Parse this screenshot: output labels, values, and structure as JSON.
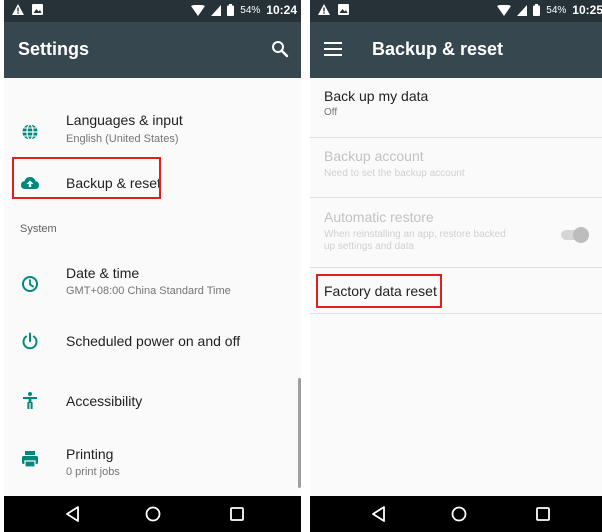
{
  "colors": {
    "status_bar": "#263238",
    "app_bar": "#37474f",
    "accent_icon": "#00897b",
    "highlight": "#e02020",
    "nav_bar": "#000000"
  },
  "left_phone": {
    "status": {
      "battery_percent": "54%",
      "time": "10:24"
    },
    "app_bar": {
      "title": "Settings",
      "action_icon": "search-icon"
    },
    "items": [
      {
        "icon": "globe-icon",
        "title": "Languages & input",
        "subtitle": "English (United States)"
      },
      {
        "icon": "cloud-upload-icon",
        "title": "Backup & reset",
        "subtitle": ""
      }
    ],
    "section_header": "System",
    "system_items": [
      {
        "icon": "clock-icon",
        "title": "Date & time",
        "subtitle": "GMT+08:00 China Standard Time"
      },
      {
        "icon": "power-icon",
        "title": "Scheduled power on and off",
        "subtitle": ""
      },
      {
        "icon": "accessibility-icon",
        "title": "Accessibility",
        "subtitle": ""
      },
      {
        "icon": "printer-icon",
        "title": "Printing",
        "subtitle": "0 print jobs"
      }
    ]
  },
  "right_phone": {
    "status": {
      "battery_percent": "54%",
      "time": "10:25"
    },
    "app_bar": {
      "nav_icon": "menu-icon",
      "title": "Backup & reset"
    },
    "items": [
      {
        "title": "Back up my data",
        "subtitle": "Off",
        "enabled": true
      },
      {
        "title": "Backup account",
        "subtitle": "Need to set the backup account",
        "enabled": false
      },
      {
        "title": "Automatic restore",
        "subtitle_line1": "When reinstalling an app, restore backed",
        "subtitle_line2": "up settings and data",
        "enabled": false,
        "toggle": "off"
      },
      {
        "title": "Factory data reset",
        "subtitle": "",
        "enabled": true
      }
    ]
  },
  "nav_bar": {
    "buttons": [
      "back-icon",
      "home-icon",
      "recents-icon"
    ]
  }
}
